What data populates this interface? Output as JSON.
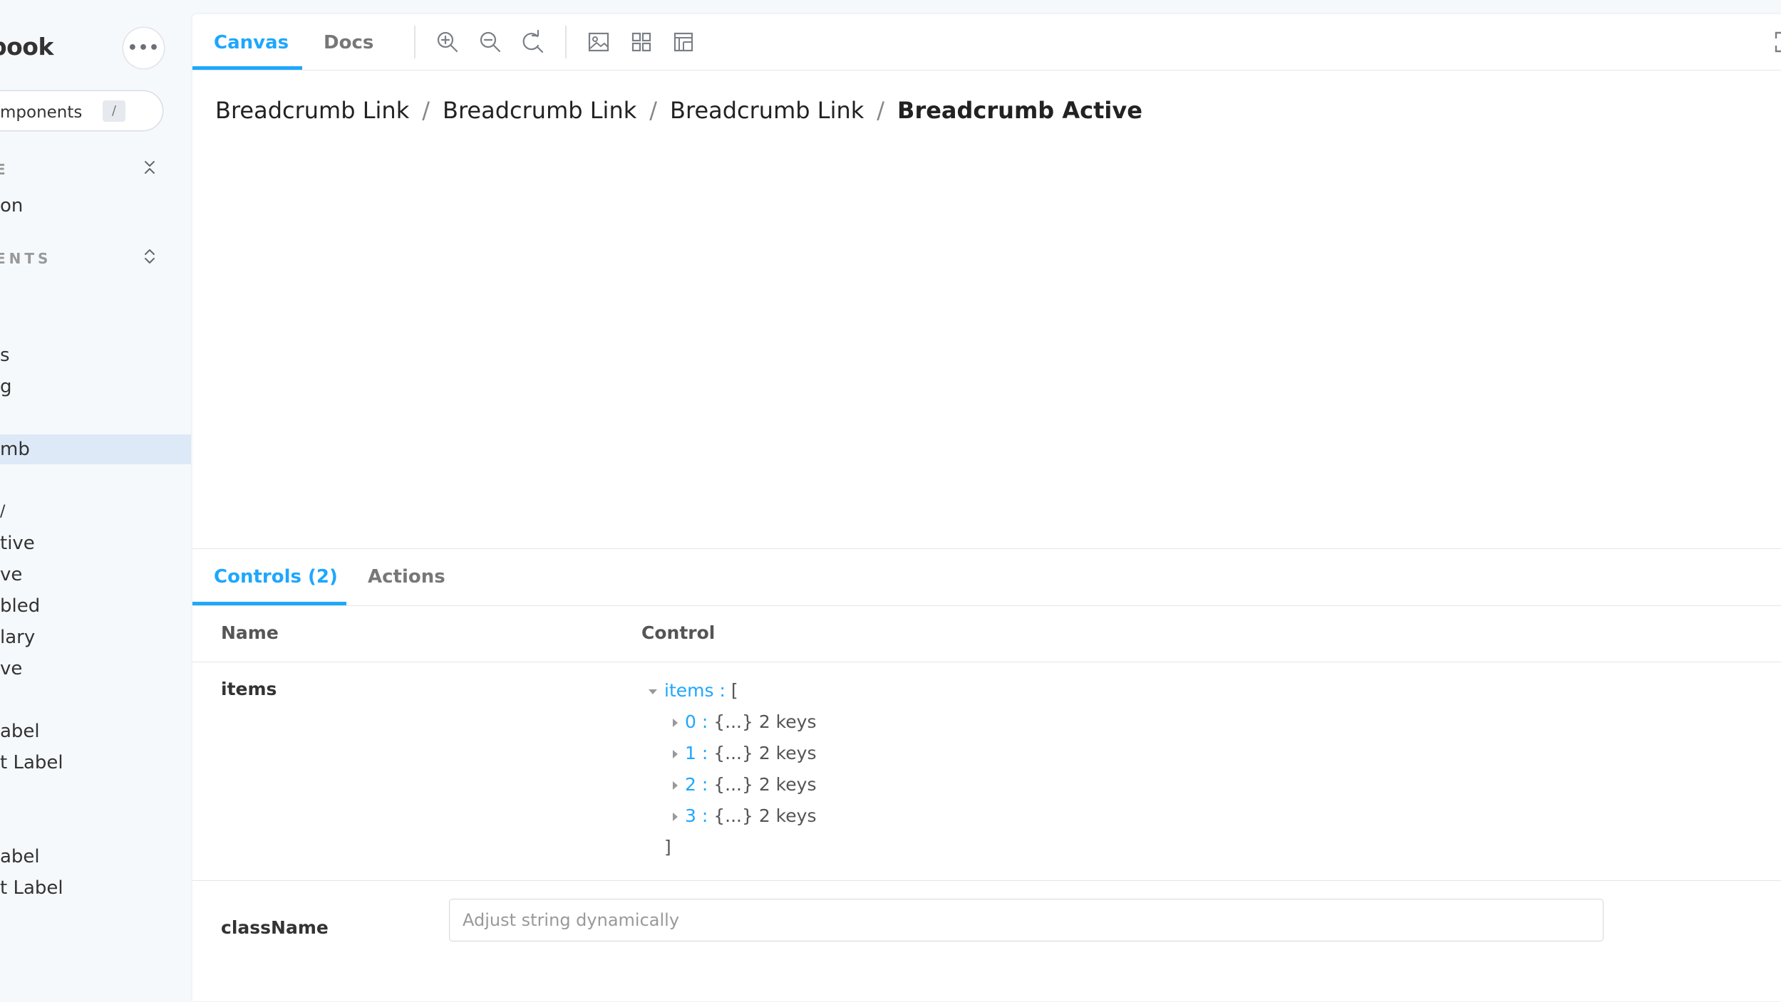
{
  "sidebar": {
    "brand": "book",
    "menu_icon": "ellipsis-icon",
    "search_label": "mponents",
    "search_shortcut": "/",
    "sections": [
      {
        "label": "E",
        "toggle_icon": "collapse-icon"
      },
      {
        "label": "ENTS",
        "toggle_icon": "expand-collapse-icon"
      }
    ],
    "items": [
      {
        "label": "on"
      },
      {
        "label": "s"
      },
      {
        "label": "g"
      },
      {
        "label": "mb",
        "active": true
      },
      {
        "label": "/"
      },
      {
        "label": "tive"
      },
      {
        "label": "ve"
      },
      {
        "label": "bled"
      },
      {
        "label": "lary"
      },
      {
        "label": "ve"
      },
      {
        "label": "abel"
      },
      {
        "label": "t Label"
      },
      {
        "label": "abel"
      },
      {
        "label": "t Label"
      }
    ]
  },
  "toolbar": {
    "tabs": [
      {
        "label": "Canvas",
        "active": true
      },
      {
        "label": "Docs",
        "active": false
      }
    ],
    "tools": [
      "zoom-in-icon",
      "zoom-out-icon",
      "reset-zoom-icon",
      "background-icon",
      "grid-icon",
      "outline-icon"
    ],
    "fullscreen_icon": "fullscreen-icon"
  },
  "preview": {
    "breadcrumbs": [
      {
        "label": "Breadcrumb Link",
        "active": false
      },
      {
        "label": "Breadcrumb Link",
        "active": false
      },
      {
        "label": "Breadcrumb Link",
        "active": false
      },
      {
        "label": "Breadcrumb Active",
        "active": true
      }
    ],
    "separator": "/"
  },
  "addons": {
    "tabs": [
      {
        "label": "Controls (2)",
        "active": true
      },
      {
        "label": "Actions",
        "active": false
      }
    ],
    "columns": {
      "name": "Name",
      "control": "Control"
    },
    "rows": [
      {
        "name": "items",
        "json": {
          "root_key": "items",
          "open": "[",
          "close": "]",
          "entries": [
            {
              "key": "0",
              "summary": "{...} 2 keys"
            },
            {
              "key": "1",
              "summary": "{...} 2 keys"
            },
            {
              "key": "2",
              "summary": "{...} 2 keys"
            },
            {
              "key": "3",
              "summary": "{...} 2 keys"
            }
          ]
        }
      },
      {
        "name": "className",
        "placeholder": "Adjust string dynamically",
        "value": ""
      }
    ]
  },
  "colors": {
    "accent": "#1ea7fd",
    "active_nav_bg": "#dde9f7",
    "sidebar_bg": "#f6f9fc"
  }
}
